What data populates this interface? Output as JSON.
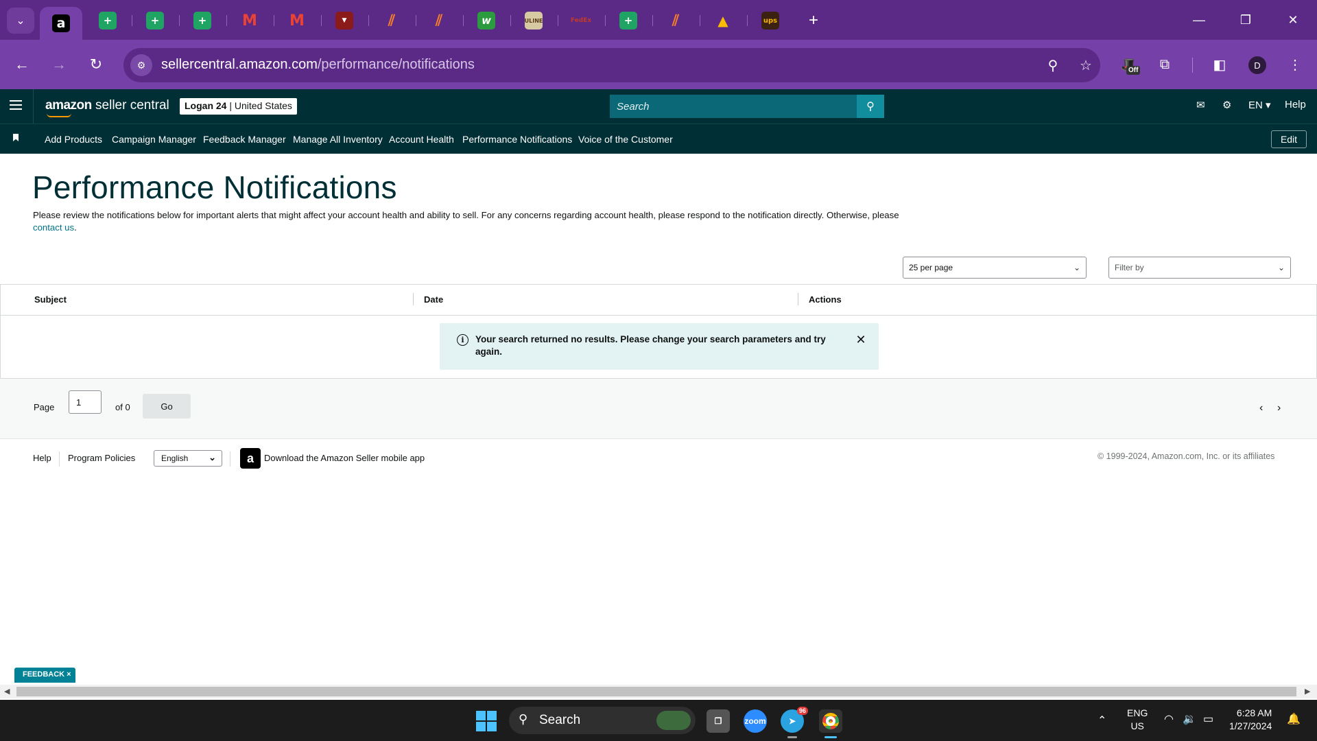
{
  "browser": {
    "tabs": [
      {
        "icon": "amazon-icon",
        "glyph": "a",
        "active": true
      },
      {
        "icon": "sheets-icon",
        "glyph": "+"
      },
      {
        "icon": "sheets-icon",
        "glyph": "+"
      },
      {
        "icon": "sheets-icon",
        "glyph": "+"
      },
      {
        "icon": "gmail-icon",
        "glyph": "M"
      },
      {
        "icon": "gmail-icon",
        "glyph": "M"
      },
      {
        "icon": "red-app-icon",
        "glyph": "▼"
      },
      {
        "icon": "stripe-icon",
        "glyph": "⫽"
      },
      {
        "icon": "stripe-icon",
        "glyph": "⫽"
      },
      {
        "icon": "w-app-icon",
        "glyph": "w"
      },
      {
        "icon": "uline-icon",
        "glyph": "ULINE"
      },
      {
        "icon": "fedex-icon",
        "glyph": "FedEx"
      },
      {
        "icon": "sheets-icon",
        "glyph": "+"
      },
      {
        "icon": "stripe-icon",
        "glyph": "⫽"
      },
      {
        "icon": "drive-icon",
        "glyph": "▲"
      },
      {
        "icon": "ups-icon",
        "glyph": "ups"
      }
    ],
    "new_tab": "+",
    "url_host": "sellercentral.amazon.com",
    "url_path": "/performance/notifications",
    "extension_badge": "Off",
    "profile_initial": "D"
  },
  "header": {
    "logo_brand": "amazon",
    "logo_product": " seller central",
    "store_name": "Logan 24",
    "store_region": " | United States",
    "search_placeholder": "Search",
    "language": "EN ▾",
    "help": "Help"
  },
  "bookmarks": {
    "items": [
      "Add Products",
      "Campaign Manager",
      "Feedback Manager",
      "Manage All Inventory",
      "Account Health",
      "Performance Notifications",
      "Voice of the Customer"
    ],
    "edit_label": "Edit"
  },
  "main": {
    "title": "Performance Notifications",
    "intro_text": "Please review the notifications below for important alerts that might affect your account health and ability to sell. For any concerns regarding account health, please respond to the notification directly. Otherwise, please ",
    "intro_link": "contact us",
    "intro_end": ".",
    "per_page": "25 per page",
    "filter_placeholder": "Filter by",
    "columns": [
      "Subject",
      "Date",
      "Actions"
    ],
    "alert_text": "Your search returned no results. Please change your search parameters and try again."
  },
  "pagination": {
    "page_label": "Page",
    "page_value": "1",
    "of_label": "of 0",
    "go_label": "Go"
  },
  "footer": {
    "help": "Help",
    "program_policies": "Program Policies",
    "language": "English",
    "download_app": "Download the Amazon Seller mobile app",
    "copyright": "© 1999-2024, Amazon.com, Inc. or its affiliates"
  },
  "feedback_button": "FEEDBACK ×",
  "taskbar": {
    "search_label": "Search",
    "telegram_badge": "96",
    "lang_top": "ENG",
    "lang_bottom": "US",
    "time": "6:28 AM",
    "date": "1/27/2024"
  },
  "colors": {
    "browser_frame": "#5b2a86",
    "seller_header": "#002f36",
    "link": "#007185",
    "alert_bg": "#e3f2f3"
  }
}
